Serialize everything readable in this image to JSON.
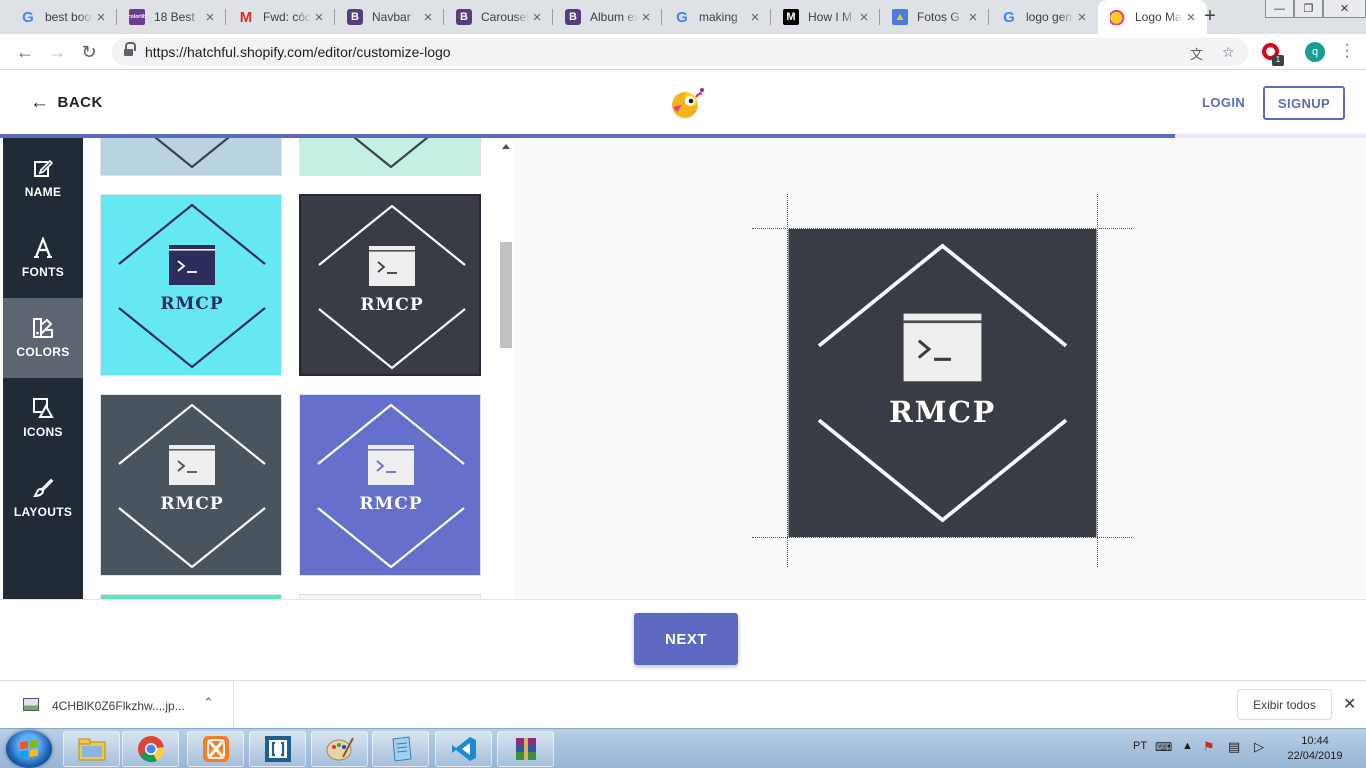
{
  "browser": {
    "tabs": [
      {
        "title": "best bootstrap",
        "icon": "google-icon"
      },
      {
        "title": "18 Best",
        "icon": "colorlib-icon"
      },
      {
        "title": "Fwd: código",
        "icon": "gmail-icon"
      },
      {
        "title": "Navbar",
        "icon": "bootstrap-icon"
      },
      {
        "title": "Carousel",
        "icon": "bootstrap-icon"
      },
      {
        "title": "Album example",
        "icon": "bootstrap-icon"
      },
      {
        "title": "making",
        "icon": "google-icon"
      },
      {
        "title": "How I M",
        "icon": "medium-icon"
      },
      {
        "title": "Fotos G",
        "icon": "fotos-icon"
      },
      {
        "title": "logo gen",
        "icon": "google-icon"
      },
      {
        "title": "Logo Maker",
        "icon": "hatchful-icon",
        "active": true
      }
    ],
    "url": "https://hatchful.shopify.com/editor/customize-logo",
    "profile_initial": "q",
    "extension_badge": "1"
  },
  "app": {
    "back_label": "BACK",
    "login_label": "LOGIN",
    "signup_label": "SIGNUP",
    "progress_fraction": 0.86,
    "accent_color": "#5c6ac4",
    "sidebar": [
      {
        "id": "name",
        "label": "NAME",
        "icon": "pencil-icon"
      },
      {
        "id": "fonts",
        "label": "FONTS",
        "icon": "font-icon"
      },
      {
        "id": "colors",
        "label": "COLORS",
        "icon": "palette-icon",
        "active": true
      },
      {
        "id": "icons",
        "label": "ICONS",
        "icon": "shapes-icon"
      },
      {
        "id": "layouts",
        "label": "LAYOUTS",
        "icon": "brush-icon"
      }
    ],
    "logo_text": "RMCP",
    "palettes": [
      {
        "bg": "#b8d4e0",
        "fg": "#3c4150",
        "plate": "#3c4150",
        "glyph": "#b8d4e0"
      },
      {
        "bg": "#c4f0e4",
        "fg": "#3c4150",
        "plate": "#3c4150",
        "glyph": "#c4f0e4"
      },
      {
        "bg": "#66e8f2",
        "fg": "#2c2d5c",
        "plate": "#2c2d5c",
        "glyph": "#ffffff"
      },
      {
        "bg": "#393c44",
        "fg": "#ffffff",
        "plate": "#eeeeee",
        "glyph": "#393c44",
        "selected": true
      },
      {
        "bg": "#49545c",
        "fg": "#ffffff",
        "plate": "#eeeeee",
        "glyph": "#49545c"
      },
      {
        "bg": "#6470cc",
        "fg": "#ffffff",
        "plate": "#eeeeee",
        "glyph": "#6470cc"
      },
      {
        "bg": "#64e2c4",
        "fg": "#ffffff",
        "plate": "#ffffff",
        "glyph": "#64e2c4"
      },
      {
        "bg": "#f4f5f7",
        "fg": "#3c4150",
        "plate": "#3c4150",
        "glyph": "#f4f5f7"
      }
    ],
    "preview": {
      "bg": "#393c44",
      "fg": "#ffffff",
      "plate": "#eeeeee",
      "glyph": "#393c44"
    },
    "next_label": "NEXT"
  },
  "downloads": {
    "file_name": "4CHBlK0Z6Flkzhw....jp...",
    "show_all_label": "Exibir todos"
  },
  "taskbar": {
    "lang": "PT",
    "time": "10:44",
    "date": "22/04/2019",
    "apps": [
      "explorer-icon",
      "chrome-icon",
      "xampp-icon",
      "brackets-icon",
      "paint-icon",
      "notepad-icon",
      "vscode-icon",
      "winrar-icon"
    ]
  }
}
